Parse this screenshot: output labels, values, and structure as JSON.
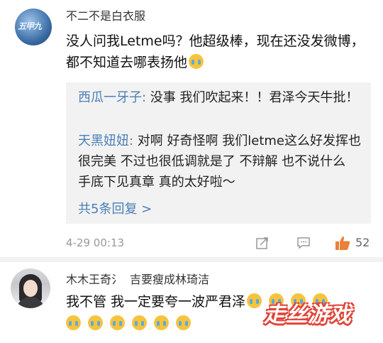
{
  "comments": [
    {
      "username": "不二不是白衣服",
      "avatar_text": "五甲九",
      "text": "没人问我Letme吗？他超级棒，现在还没发微博，都不知道去哪表扬他",
      "replies": [
        {
          "name": "西瓜一牙子:",
          "text": " 没事 我们吹起来！！君泽今天牛批！"
        },
        {
          "name": "天黑妞妞:",
          "text": " 对啊 好奇怪啊 我们letme这么好发挥也很完美 不过也很低调就是了 不辩解 也不说什么 手底下见真章 真的太好啦～"
        }
      ],
      "more_replies": "共5条回复 >",
      "timestamp": "4-29 00:13",
      "likes": "52"
    },
    {
      "username": "木木王奇氵",
      "username_extra": "吉要瘦成林琦洁",
      "text": "我不管 我一定要夸一波严君泽"
    }
  ],
  "watermark": "走丝游戏",
  "icons": {
    "share": "share-icon",
    "comment": "comment-icon",
    "like": "thumbs-up-icon",
    "emoji": "crying-face-emoji"
  },
  "colors": {
    "link": "#4a7fb7",
    "like": "#e8813a",
    "reply_bg": "#f2f2f2"
  }
}
